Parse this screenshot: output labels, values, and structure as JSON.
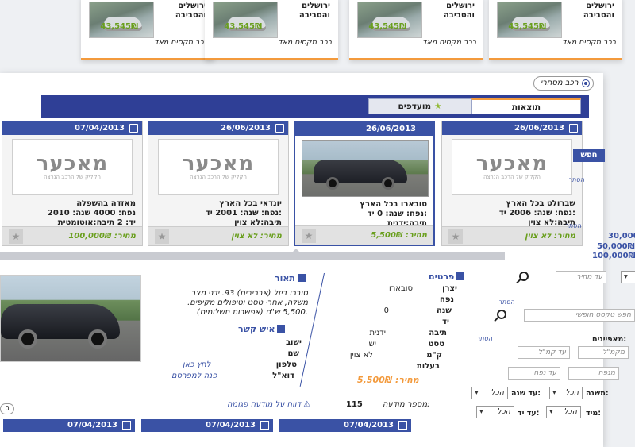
{
  "top_cards": [
    {
      "city": "ירושלים והסביבה",
      "price": "43,545₪",
      "desc": "רכב מקסים מאד"
    },
    {
      "city": "ירושלים והסביבה",
      "price": "43,545₪",
      "desc": "רכב מקסים מאד"
    },
    {
      "city": "ירושלים והסביבה",
      "price": "43,545₪",
      "desc": "רכב מקסים מאד"
    },
    {
      "city": "ירושלים והסביבה",
      "price": "43,545₪",
      "desc": "רכב מקסים מאד"
    }
  ],
  "business_toggle": "רכב מסחרי",
  "tabs": {
    "results": "תוצאות",
    "favorites": "מועדפים"
  },
  "listings": [
    {
      "date": "26/06/2013",
      "line1": "שברולט בכל הארץ",
      "line2": "נפח:  שנה: 2006 יד:",
      "line3": "תיבה:לא צוין",
      "price": "מחיר: לא צוין",
      "logo": "מאכער",
      "logo_sub": "הקליק של הרכב הנרצה"
    },
    {
      "date": "26/06/2013",
      "line1": "סובארו בכל הארץ",
      "line2": "נפח:  שנה: 0 יד:",
      "line3": "תיבה:ידנית",
      "price": "מחיר: 5,500₪"
    },
    {
      "date": "26/06/2013",
      "line1": "יונדאי בכל הארץ",
      "line2": "נפח:  שנה: 2001 יד:",
      "line3": "תיבה:לא צוין",
      "price": "מחיר: לא צוין",
      "logo": "מאכער",
      "logo_sub": "הקליק של הרכב הנרצה"
    },
    {
      "date": "07/04/2013",
      "line1": "מאזדה בהשפלה",
      "line2": "נפח: 4000  שנה: 2010",
      "line3": "יד: 2  תיבה:אוטומטית",
      "price": "מחיר: 100,000₪",
      "logo": "מאכער",
      "logo_sub": "הקליק של הרכב הנרצה"
    }
  ],
  "detail": {
    "details_title": "פרטים",
    "desc_title": "תאור",
    "desc_text": "סוברו דיזל (אבריבים) 93. ידני מצב משלה, אחרי טסט וטיפולים מקיפים. 5,500 ש\"ח (אפשרות תשלומים).",
    "fields": [
      {
        "label": "יצרן",
        "value": "סובארו"
      },
      {
        "label": "נפח",
        "value": ""
      },
      {
        "label": "שנה",
        "value": "0"
      },
      {
        "label": "יד",
        "value": ""
      },
      {
        "label": "תיבה",
        "value": "ידנית"
      },
      {
        "label": "טסט",
        "value": "יש"
      },
      {
        "label": "ק\"מ",
        "value": "לא צוין"
      },
      {
        "label": "בעלות",
        "value": ""
      }
    ],
    "price": "מחיר: 5,500₪",
    "contact_title": "איש קשר",
    "contact": [
      {
        "label": "ישוב",
        "value": ""
      },
      {
        "label": "שם",
        "value": ""
      },
      {
        "label": "טלפון",
        "value": "לחץ כאן"
      },
      {
        "label": "דוא\"ל",
        "value": "פנה למפרסם"
      }
    ],
    "ad_number_label": "מספר מודעה:",
    "ad_number": "115",
    "report_link": "דווח על מודעה פגומה",
    "page_counter": "0"
  },
  "bottom_dates": [
    "07/04/2013",
    "07/04/2013",
    "07/04/2013"
  ],
  "filters": {
    "search_button": "חפש",
    "label_search": "הסתר",
    "label_price": "הסתר",
    "prices": [
      "30,000₪",
      "50,000₪",
      "100,000₪"
    ],
    "price_to_placeholder": "עד מחיר",
    "free_text_placeholder": "חפש טקסט חופשי",
    "label_free": "הסתר",
    "label_more": "הסתר",
    "from_label": "מאפיינים:",
    "km_from": "מקמ\"ל",
    "km_to": "עד קמ\"ל",
    "vol_from": "מנפח",
    "vol_to": "עד נפח",
    "year_label": "משנה:",
    "year_from": "הכל",
    "year_to_label": "עד שנה:",
    "year_to": "הכל",
    "hand_label": "מיד:",
    "hand_from": "הכל",
    "hand_to_label": "עד יד:",
    "hand_to": "הכל"
  }
}
